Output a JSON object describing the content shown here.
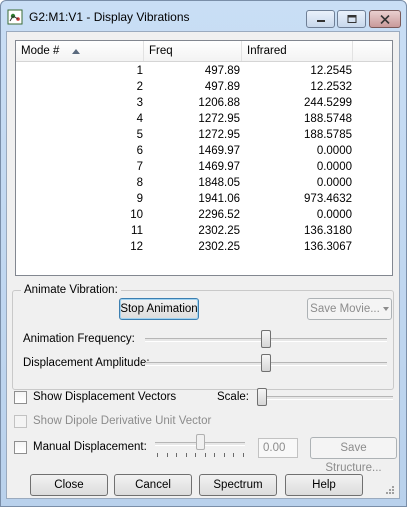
{
  "window": {
    "title": "G2:M1:V1 - Display Vibrations",
    "controls": {
      "minimize": "minimize-icon",
      "maximize": "maximize-icon",
      "close": "close-icon"
    }
  },
  "list": {
    "columns": [
      "Mode #",
      "Freq",
      "Infrared"
    ],
    "sort_icon": "sort-ascending-icon",
    "rows": [
      {
        "mode": "1",
        "freq": "497.89",
        "ir": "12.2545"
      },
      {
        "mode": "2",
        "freq": "497.89",
        "ir": "12.2532"
      },
      {
        "mode": "3",
        "freq": "1206.88",
        "ir": "244.5299"
      },
      {
        "mode": "4",
        "freq": "1272.95",
        "ir": "188.5748"
      },
      {
        "mode": "5",
        "freq": "1272.95",
        "ir": "188.5785"
      },
      {
        "mode": "6",
        "freq": "1469.97",
        "ir": "0.0000"
      },
      {
        "mode": "7",
        "freq": "1469.97",
        "ir": "0.0000"
      },
      {
        "mode": "8",
        "freq": "1848.05",
        "ir": "0.0000"
      },
      {
        "mode": "9",
        "freq": "1941.06",
        "ir": "973.4632"
      },
      {
        "mode": "10",
        "freq": "2296.52",
        "ir": "0.0000"
      },
      {
        "mode": "11",
        "freq": "2302.25",
        "ir": "136.3180"
      },
      {
        "mode": "12",
        "freq": "2302.25",
        "ir": "136.3067"
      }
    ]
  },
  "animate": {
    "group_label": "Animate Vibration:",
    "stop_button": "Stop Animation",
    "save_movie_button": "Save Movie...",
    "frequency_label": "Animation Frequency:",
    "frequency_level": 0.5,
    "amplitude_label": "Displacement Amplitude:",
    "amplitude_level": 0.5
  },
  "options": {
    "show_displacement_vectors": "Show Displacement Vectors",
    "show_displacement_vectors_checked": false,
    "scale_label": "Scale:",
    "scale_level": 0.0,
    "show_dipole_vector": "Show Dipole Derivative Unit Vector",
    "show_dipole_vector_checked": false,
    "manual_displacement": "Manual Displacement:",
    "manual_displacement_checked": false,
    "manual_level": 0.5,
    "manual_value": "0.00",
    "save_structure_button": "Save Structure..."
  },
  "footer": {
    "close": "Close",
    "cancel": "Cancel",
    "spectrum": "Spectrum",
    "help": "Help"
  },
  "colors": {
    "title_bar": "#c9def5",
    "dialog_bg": "#f0f0f0",
    "list_bg": "#ffffff"
  }
}
